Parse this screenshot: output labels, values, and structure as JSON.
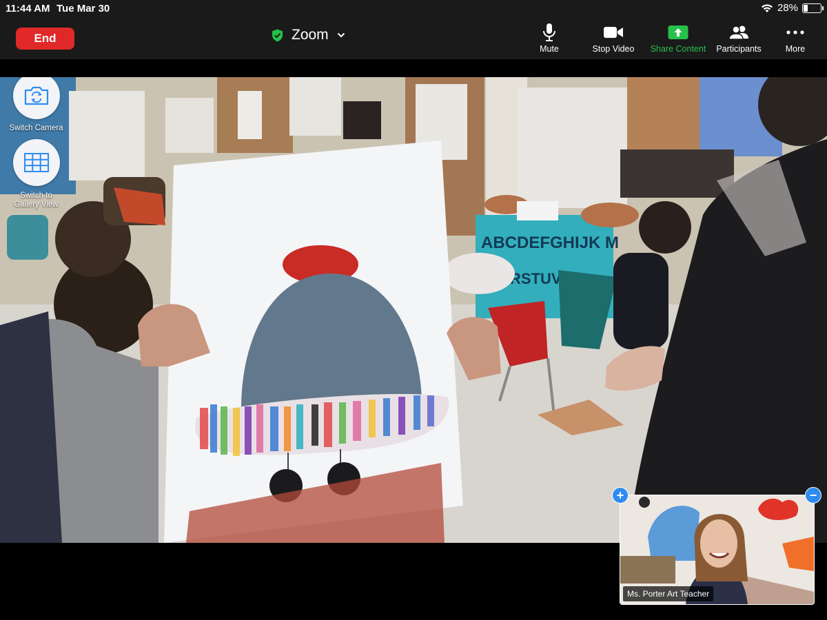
{
  "status": {
    "time": "11:44 AM",
    "date": "Tue Mar 30",
    "battery": "28%",
    "battery_level": 0.28
  },
  "toolbar": {
    "end_label": "End",
    "meeting_title": "Zoom",
    "mute_label": "Mute",
    "stop_video_label": "Stop Video",
    "share_label": "Share Content",
    "participants_label": "Participants",
    "more_label": "More"
  },
  "floating": {
    "switch_camera_label": "Switch Camera",
    "gallery_line1": "Switch to",
    "gallery_line2": "Gallery View"
  },
  "self_view": {
    "name": "Ms. Porter Art Teacher",
    "add_symbol": "+",
    "minimize_symbol": "−"
  },
  "scene": {
    "alphabet_text": "ABCDEFGHIJK M",
    "alphabet_text2": "RSTUVW"
  },
  "colors": {
    "end": "#e02828",
    "share": "#27c04b",
    "shield": "#27c04b",
    "accent_blue": "#2e8cf0"
  },
  "icons": [
    "wifi-icon",
    "battery-icon",
    "shield-icon",
    "chevron-down-icon",
    "microphone-icon",
    "video-camera-icon",
    "share-arrow-icon",
    "participants-icon",
    "more-icon",
    "switch-camera-icon",
    "gallery-grid-icon"
  ]
}
